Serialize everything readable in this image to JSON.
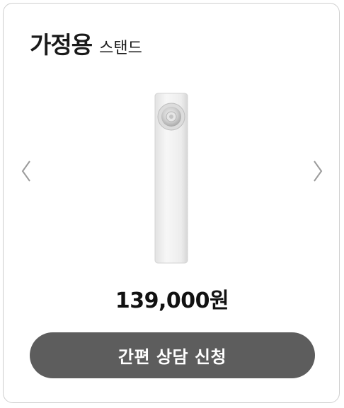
{
  "card": {
    "title": "가정용",
    "subtitle": "스탠드"
  },
  "carousel": {
    "prev_icon": "chevron-left-icon",
    "next_icon": "chevron-right-icon"
  },
  "product": {
    "image_icon": "stand-air-conditioner",
    "price": "139,000원"
  },
  "cta": {
    "label": "간편 상담 신청"
  },
  "colors": {
    "button_bg": "#5d5d5d",
    "button_text": "#ffffff",
    "border": "#cfcfcf",
    "text": "#111111"
  }
}
